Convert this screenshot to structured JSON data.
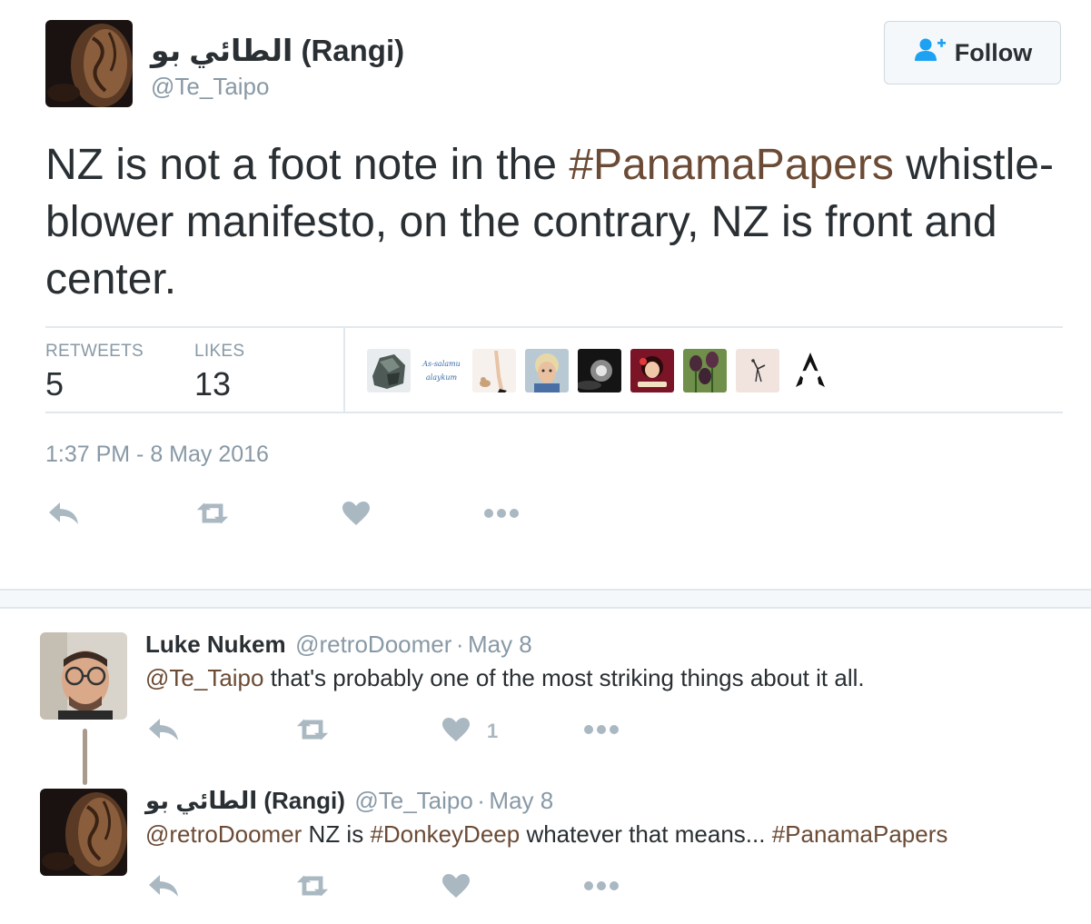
{
  "tweet": {
    "author_name": "الطائي بو (Rangi)",
    "author_handle": "@Te_Taipo",
    "follow_label": "Follow",
    "text_parts": [
      "NZ is not a foot note in the ",
      "#PanamaPapers",
      " whistle-blower manifesto, on the contrary, NZ is front and center."
    ],
    "retweets_label": "RETWEETS",
    "retweets_count": "5",
    "likes_label": "LIKES",
    "likes_count": "13",
    "liker_avatars": [
      "rock-avatar",
      "as-salamu-alaykum-avatar",
      "legs-avatar",
      "woman-avatar",
      "light-avatar",
      "pinup-avatar",
      "tulips-avatar",
      "bird-avatar",
      "star-logo-avatar"
    ],
    "liker_avatar_text": "As-salamu alaykum",
    "timestamp": "1:37 PM - 8 May 2016"
  },
  "replies": [
    {
      "name": "Luke Nukem",
      "handle": "@retroDoomer",
      "sep": "·",
      "date": "May 8",
      "mention": "@Te_Taipo",
      "text": " that's probably one of the most striking things about it all.",
      "like_count": "1"
    },
    {
      "name": "الطائي بو (Rangi)",
      "handle": "@Te_Taipo",
      "sep": "·",
      "date": "May 8",
      "mention": "@retroDoomer",
      "text1": " NZ is ",
      "hashtag1": "#DonkeyDeep",
      "text2": " whatever that means... ",
      "hashtag2": "#PanamaPapers"
    }
  ],
  "colors": {
    "text": "#292f33",
    "muted": "#8899a6",
    "link": "#6b4b35",
    "action_icon": "#aab8c2",
    "divider": "#e1e8ed"
  }
}
